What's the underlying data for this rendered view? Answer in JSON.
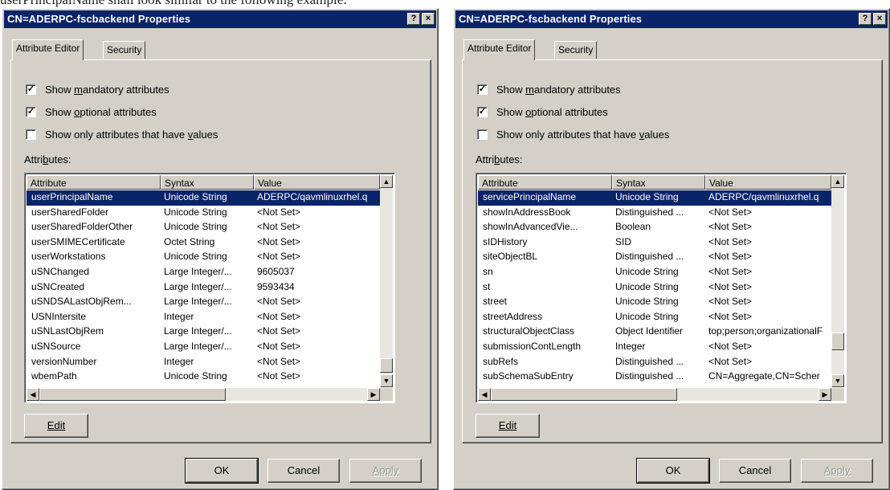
{
  "caption": "userPrincipalName shall look similar to the following example:",
  "colors": {
    "titlebar": "#0a246a",
    "selection": "#0a246a",
    "dialog_bg": "#d4d0c8"
  },
  "dialogs": [
    {
      "title": "CN=ADERPC-fscbackend Properties",
      "help_btn": "?",
      "close_btn": "×",
      "tabs": [
        "Attribute Editor",
        "Security"
      ],
      "checkboxes": [
        {
          "pre": "Show ",
          "u": "m",
          "post": "andatory attributes",
          "checked": true
        },
        {
          "pre": "Show ",
          "u": "o",
          "post": "ptional attributes",
          "checked": true
        },
        {
          "pre": "Show only attributes that have ",
          "u": "v",
          "post": "alues",
          "checked": false
        }
      ],
      "attributes_label": {
        "pre": "Attri",
        "u": "b",
        "post": "utes:"
      },
      "columns": [
        "Attribute",
        "Syntax",
        "Value"
      ],
      "rows": [
        [
          "userPrincipalName",
          "Unicode String",
          "ADERPC/qavmlinuxrhel.q"
        ],
        [
          "userSharedFolder",
          "Unicode String",
          "<Not Set>"
        ],
        [
          "userSharedFolderOther",
          "Unicode String",
          "<Not Set>"
        ],
        [
          "userSMIMECertificate",
          "Octet String",
          "<Not Set>"
        ],
        [
          "userWorkstations",
          "Unicode String",
          "<Not Set>"
        ],
        [
          "uSNChanged",
          "Large Integer/...",
          "9605037"
        ],
        [
          "uSNCreated",
          "Large Integer/...",
          "9593434"
        ],
        [
          "uSNDSALastObjRem...",
          "Large Integer/...",
          "<Not Set>"
        ],
        [
          "USNIntersite",
          "Integer",
          "<Not Set>"
        ],
        [
          "uSNLastObjRem",
          "Large Integer/...",
          "<Not Set>"
        ],
        [
          "uSNSource",
          "Large Integer/...",
          "<Not Set>"
        ],
        [
          "versionNumber",
          "Integer",
          "<Not Set>"
        ],
        [
          "wbemPath",
          "Unicode String",
          "<Not Set>"
        ]
      ],
      "selected_row": 0,
      "edit_label": "Edit",
      "ok_label": "OK",
      "cancel_label": "Cancel",
      "apply_label": "Apply"
    },
    {
      "title": "CN=ADERPC-fscbackend Properties",
      "help_btn": "?",
      "close_btn": "×",
      "tabs": [
        "Attribute Editor",
        "Security"
      ],
      "checkboxes": [
        {
          "pre": "Show ",
          "u": "m",
          "post": "andatory attributes",
          "checked": true
        },
        {
          "pre": "Show ",
          "u": "o",
          "post": "ptional attributes",
          "checked": true
        },
        {
          "pre": "Show only attributes that have ",
          "u": "v",
          "post": "alues",
          "checked": false
        }
      ],
      "attributes_label": {
        "pre": "Attri",
        "u": "b",
        "post": "utes:"
      },
      "columns": [
        "Attribute",
        "Syntax",
        "Value"
      ],
      "rows": [
        [
          "servicePrincipalName",
          "Unicode String",
          "ADERPC/qavmlinuxrhel.q"
        ],
        [
          "showInAddressBook",
          "Distinguished ...",
          "<Not Set>"
        ],
        [
          "showInAdvancedVie...",
          "Boolean",
          "<Not Set>"
        ],
        [
          "sIDHistory",
          "SID",
          "<Not Set>"
        ],
        [
          "siteObjectBL",
          "Distinguished ...",
          "<Not Set>"
        ],
        [
          "sn",
          "Unicode String",
          "<Not Set>"
        ],
        [
          "st",
          "Unicode String",
          "<Not Set>"
        ],
        [
          "street",
          "Unicode String",
          "<Not Set>"
        ],
        [
          "streetAddress",
          "Unicode String",
          "<Not Set>"
        ],
        [
          "structuralObjectClass",
          "Object Identifier",
          "top;person;organizationalF"
        ],
        [
          "submissionContLength",
          "Integer",
          "<Not Set>"
        ],
        [
          "subRefs",
          "Distinguished ...",
          "<Not Set>"
        ],
        [
          "subSchemaSubEntry",
          "Distinguished ...",
          "CN=Aggregate,CN=Scher"
        ]
      ],
      "selected_row": 0,
      "edit_label": "Edit",
      "ok_label": "OK",
      "cancel_label": "Cancel",
      "apply_label": "Apply"
    }
  ]
}
